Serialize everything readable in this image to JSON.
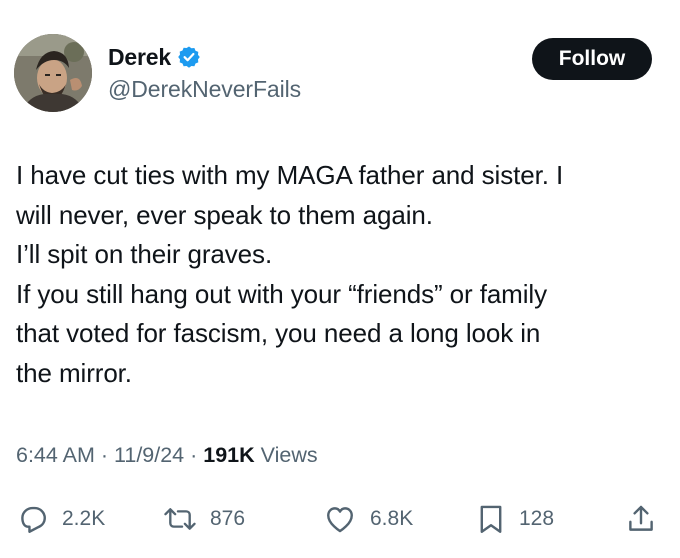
{
  "user": {
    "display_name": "Derek",
    "handle": "@DerekNeverFails",
    "verified": true,
    "verified_color": "#1d9bf0"
  },
  "follow_button": {
    "label": "Follow"
  },
  "tweet": {
    "lines": [
      "I have cut ties with my MAGA father and sister.  I",
      "will never, ever speak to them again.",
      "I’ll spit on their graves.",
      "If you still hang out with your “friends” or family",
      "that voted for fascism, you need a long look in",
      "the mirror."
    ]
  },
  "meta": {
    "time": "6:44 AM",
    "separator": " · ",
    "date": "11/9/24",
    "views_count": "191K",
    "views_label": " Views"
  },
  "actions": {
    "replies": {
      "icon": "reply-icon",
      "count": "2.2K"
    },
    "reposts": {
      "icon": "repost-icon",
      "count": "876"
    },
    "likes": {
      "icon": "heart-icon",
      "count": "6.8K"
    },
    "bookmarks": {
      "icon": "bookmark-icon",
      "count": "128"
    },
    "share": {
      "icon": "share-icon"
    }
  },
  "colors": {
    "text_primary": "#0f1419",
    "text_secondary": "#536471",
    "follow_bg": "#0f1419",
    "follow_text": "#ffffff"
  }
}
